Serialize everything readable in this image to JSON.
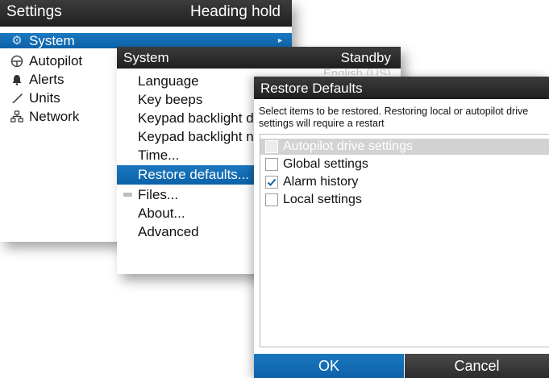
{
  "settings": {
    "title": "Settings",
    "status": "Heading hold",
    "items": [
      {
        "icon": "gear-icon",
        "label": "System"
      },
      {
        "icon": "autopilot-icon",
        "label": "Autopilot"
      },
      {
        "icon": "bell-icon",
        "label": "Alerts"
      },
      {
        "icon": "ruler-icon",
        "label": "Units"
      },
      {
        "icon": "network-icon",
        "label": "Network"
      }
    ],
    "selected": "System"
  },
  "system": {
    "title": "System",
    "status": "Standby",
    "items": [
      {
        "label": "Language"
      },
      {
        "label": "Key beeps"
      },
      {
        "label": "Keypad backlight day"
      },
      {
        "label": "Keypad backlight night"
      },
      {
        "label": "Time..."
      },
      {
        "label": "Restore defaults..."
      },
      {
        "label": "Files..."
      },
      {
        "label": "About..."
      },
      {
        "label": "Advanced"
      }
    ],
    "selected": "Restore defaults...",
    "language_value": "English (US)"
  },
  "restore": {
    "title": "Restore Defaults",
    "description": "Select items to be restored. Restoring local or autopilot drive settings will require a restart",
    "options": [
      {
        "label": "Autopilot drive settings",
        "checked": false,
        "disabled": true
      },
      {
        "label": "Global settings",
        "checked": false,
        "disabled": false
      },
      {
        "label": "Alarm history",
        "checked": true,
        "disabled": false
      },
      {
        "label": "Local settings",
        "checked": false,
        "disabled": false
      }
    ],
    "ok_label": "OK",
    "cancel_label": "Cancel"
  },
  "colors": {
    "accent": "#0d62a8",
    "titlebar": "#262626",
    "cancel": "#3a3a3a"
  }
}
